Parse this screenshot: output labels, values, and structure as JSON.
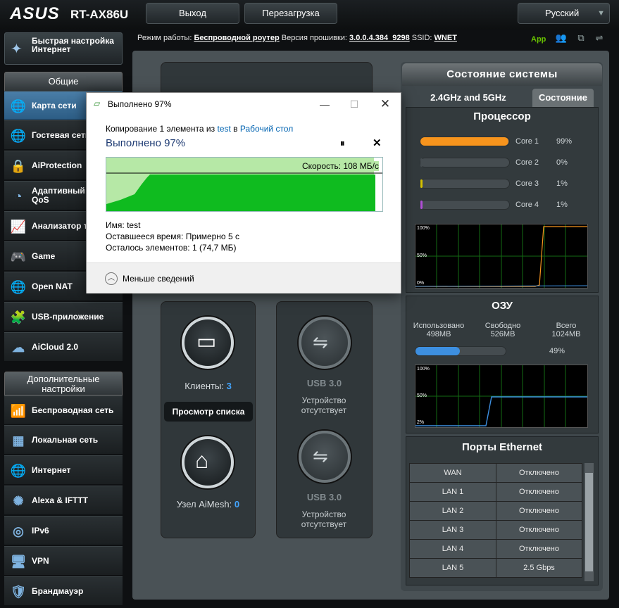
{
  "header": {
    "logo": "ASUS",
    "model": "RT-AX86U",
    "logout": "Выход",
    "reboot": "Перезагрузка",
    "language": "Русский"
  },
  "status_line": {
    "mode_label": "Режим работы:",
    "mode_value": "Беспроводной роутер",
    "fw_label": "Версия прошивки:",
    "fw_value": "3.0.0.4.384_9298",
    "ssid_label": "SSID:",
    "ssid_value": "WNET",
    "app": "App"
  },
  "sidebar": {
    "quick_setup": "Быстрая настройка Интернет",
    "general_header": "Общие",
    "general": [
      "Карта сети",
      "Гостевая сеть",
      "AiProtection",
      "Адаптивный сервис QoS",
      "Анализатор трафика",
      "Game",
      "Open NAT",
      "USB-приложение",
      "AiCloud 2.0"
    ],
    "advanced_header": "Дополнительные настройки",
    "advanced": [
      "Беспроводная сеть",
      "Локальная сеть",
      "Интернет",
      "Alexa & IFTTT",
      "IPv6",
      "VPN",
      "Брандмауэр"
    ]
  },
  "map": {
    "clients_label": "Клиенты:",
    "clients_count": "3",
    "view_list": "Просмотр списка",
    "aimesh_label": "Узел AiMesh:",
    "aimesh_count": "0",
    "usb1_title": "USB 3.0",
    "usb1_status": "Устройство отсутствует",
    "usb2_title": "USB 3.0",
    "usb2_status": "Устройство отсутствует"
  },
  "system": {
    "title": "Состояние системы",
    "tab_band": "2.4GHz and 5GHz",
    "tab_status": "Состояние",
    "cpu_title": "Процессор",
    "cores": [
      {
        "name": "Core 1",
        "pct": "99%",
        "value": 0.99,
        "color": "#f7941d"
      },
      {
        "name": "Core 2",
        "pct": "0%",
        "value": 0.0,
        "color": "#454c50"
      },
      {
        "name": "Core 3",
        "pct": "1%",
        "value": 0.01,
        "color": "#d6c200"
      },
      {
        "name": "Core 4",
        "pct": "1%",
        "value": 0.01,
        "color": "#b04fd6"
      }
    ],
    "cpu_graph_labels": [
      "100%",
      "50%",
      "0%"
    ],
    "ram_title": "ОЗУ",
    "ram_used_label": "Использовано",
    "ram_used": "498MB",
    "ram_free_label": "Свободно",
    "ram_free": "526MB",
    "ram_total_label": "Всего",
    "ram_total": "1024MB",
    "ram_pct": "49%",
    "ram_value": 0.49,
    "ram_graph_labels": [
      "100%",
      "50%",
      "2%"
    ],
    "eth_title": "Порты Ethernet",
    "ports": [
      {
        "name": "WAN",
        "status": "Отключено"
      },
      {
        "name": "LAN 1",
        "status": "Отключено"
      },
      {
        "name": "LAN 2",
        "status": "Отключено"
      },
      {
        "name": "LAN 3",
        "status": "Отключено"
      },
      {
        "name": "LAN 4",
        "status": "Отключено"
      },
      {
        "name": "LAN 5",
        "status": "2.5 Gbps"
      }
    ]
  },
  "dialog": {
    "title": "Выполнено 97%",
    "copy_prefix": "Копирование 1 элемента из",
    "copy_src": "test",
    "copy_mid": "в",
    "copy_dst": "Рабочий стол",
    "progress_text": "Выполнено 97%",
    "speed": "Скорость: 108 МБ/с",
    "progress_value": 0.97,
    "name_label": "Имя:",
    "name_value": "test",
    "time_label": "Оставшееся время:",
    "time_value": "Примерно 5 с",
    "items_label": "Осталось элементов:",
    "items_value": "1 (74,7 МБ)",
    "less_details": "Меньше сведений"
  }
}
